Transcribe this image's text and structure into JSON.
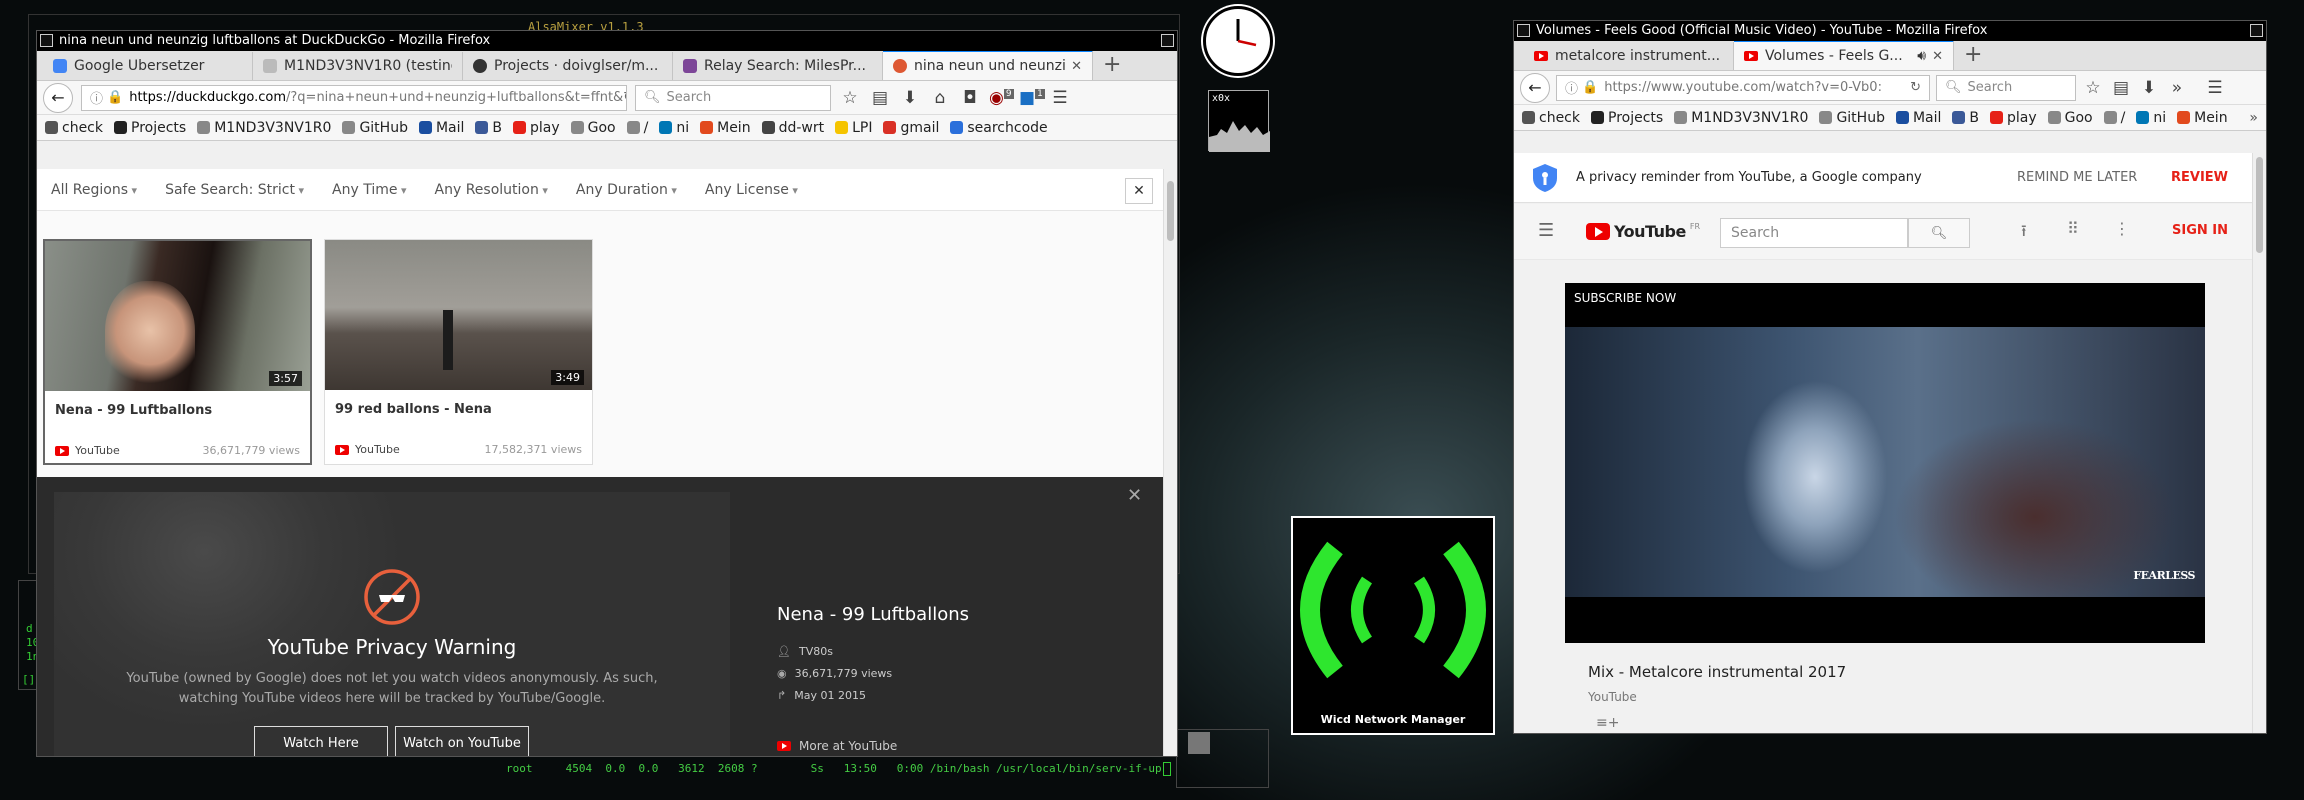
{
  "desktop": {
    "terminal_topbar": "AlsaMixer v1.1.3",
    "terminal_bottom": "root     4504  0.0  0.0   3612  2608 ?        Ss   13:50   0:00 /bin/bash /usr/local/bin/serv-if-up",
    "terminal_left_lines": [
      "d",
      "10",
      "1n",
      "[]-"
    ],
    "xos_label": "x0x",
    "wicd_label": "Wicd Network Manager"
  },
  "ddg": {
    "title": "nina neun und neunzig luftballons at DuckDuckGo - Mozilla Firefox",
    "tabs": [
      {
        "label": "Google Übersetzer",
        "color": "#4285f4"
      },
      {
        "label": "M1ND3V3NV1R0 (testing...",
        "color": "#888888"
      },
      {
        "label": "Projects · doivglser/m...",
        "color": "#333333"
      },
      {
        "label": "Relay Search: MilesPr...",
        "color": "#7d4698"
      },
      {
        "label": "nina neun und neunzi...",
        "color": "#de5833"
      }
    ],
    "url_host": "https://duckduckgo.com",
    "url_rest": "/?q=nina+neun+und+neunzig+luftballons&t=ffnt&",
    "search_placeholder": "Search",
    "badge_ublock": "9",
    "badge_s": "1",
    "bookmarks": [
      {
        "label": "check",
        "color": "#555555"
      },
      {
        "label": "Projects",
        "color": "#222222"
      },
      {
        "label": "M1ND3V3NV1R0",
        "color": "#888888"
      },
      {
        "label": "GitHub",
        "color": "#888888"
      },
      {
        "label": "Mail",
        "color": "#1a4ea0"
      },
      {
        "label": "B",
        "color": "#3b5998"
      },
      {
        "label": "play",
        "color": "#e62117"
      },
      {
        "label": "Goo",
        "color": "#888888"
      },
      {
        "label": "/",
        "color": "#888888"
      },
      {
        "label": "ni",
        "color": "#0077b5"
      },
      {
        "label": "Mein",
        "color": "#e24a1e"
      },
      {
        "label": "dd-wrt",
        "color": "#444444"
      },
      {
        "label": "LPI",
        "color": "#f5c400"
      },
      {
        "label": "gmail",
        "color": "#d93025"
      },
      {
        "label": "searchcode",
        "color": "#2a6fdb"
      }
    ],
    "filters": [
      "All Regions",
      "Safe Search: Strict",
      "Any Time",
      "Any Resolution",
      "Any Duration",
      "Any License"
    ],
    "results": [
      {
        "title": "Nena - 99 Luftballons",
        "duration": "3:57",
        "source": "YouTube",
        "views": "36,671,779 views"
      },
      {
        "title": "99 red ballons - Nena",
        "duration": "3:49",
        "source": "YouTube",
        "views": "17,582,371 views"
      }
    ],
    "warning": {
      "title": "YouTube Privacy Warning",
      "body": "YouTube (owned by Google) does not let you watch videos anonymously. As such, watching YouTube videos here will be tracked by YouTube/Google.",
      "watch_here": "Watch Here",
      "watch_youtube": "Watch on YouTube"
    },
    "detail": {
      "title": "Nena - 99 Luftballons",
      "channel": "TV80s",
      "views": "36,671,779 views",
      "date": "May 01 2015",
      "more": "More at YouTube"
    }
  },
  "yt": {
    "title": "Volumes - Feels Good (Official Music Video) - YouTube - Mozilla Firefox",
    "tabs": [
      {
        "label": "metalcore instrument...",
        "color": "#e62117"
      },
      {
        "label": "Volumes - Feels G...",
        "color": "#e62117"
      }
    ],
    "url": "https://www.youtube.com/watch?v=0-Vb0:",
    "search_placeholder": "Search",
    "bookmarks": [
      {
        "label": "check",
        "color": "#555555"
      },
      {
        "label": "Projects",
        "color": "#222222"
      },
      {
        "label": "M1ND3V3NV1R0",
        "color": "#888888"
      },
      {
        "label": "GitHub",
        "color": "#888888"
      },
      {
        "label": "Mail",
        "color": "#1a4ea0"
      },
      {
        "label": "B",
        "color": "#3b5998"
      },
      {
        "label": "play",
        "color": "#e62117"
      },
      {
        "label": "Goo",
        "color": "#888888"
      },
      {
        "label": "/",
        "color": "#888888"
      },
      {
        "label": "ni",
        "color": "#0077b5"
      },
      {
        "label": "Mein",
        "color": "#e24a1e"
      }
    ],
    "privacy_text": "A privacy reminder from YouTube, a Google company",
    "remind_later": "REMIND ME LATER",
    "review": "REVIEW",
    "logo": "YouTube",
    "logo_sup": "FR",
    "search_box": "Search",
    "sign_in": "SIGN IN",
    "subscribe_now": "SUBSCRIBE NOW",
    "watermark": "FEARLESS",
    "mix_title": "Mix - Metalcore instrumental 2017",
    "mix_channel": "YouTube"
  }
}
